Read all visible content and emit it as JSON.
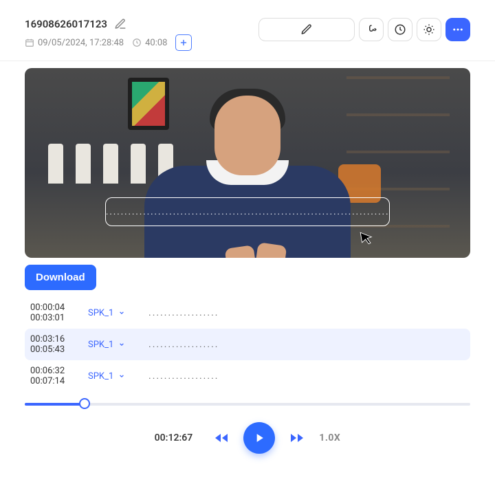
{
  "header": {
    "title": "16908626017123",
    "date": "09/05/2024, 17:28:48",
    "duration": "40:08"
  },
  "actions": {
    "download_label": "Download"
  },
  "caption": {
    "text": "...................................................................................."
  },
  "transcript": {
    "segments": [
      {
        "start": "00:00:04",
        "end": "00:03:01",
        "speaker": "SPK_1",
        "text": "..................",
        "active": false
      },
      {
        "start": "00:03:16",
        "end": "00:05:43",
        "speaker": "SPK_1",
        "text": "..................",
        "active": true
      },
      {
        "start": "00:06:32",
        "end": "00:07:14",
        "speaker": "SPK_1",
        "text": "..................",
        "active": false
      }
    ]
  },
  "player": {
    "current_time": "00:12:67",
    "speed": "1.0X",
    "progress_pct": 13.5
  }
}
